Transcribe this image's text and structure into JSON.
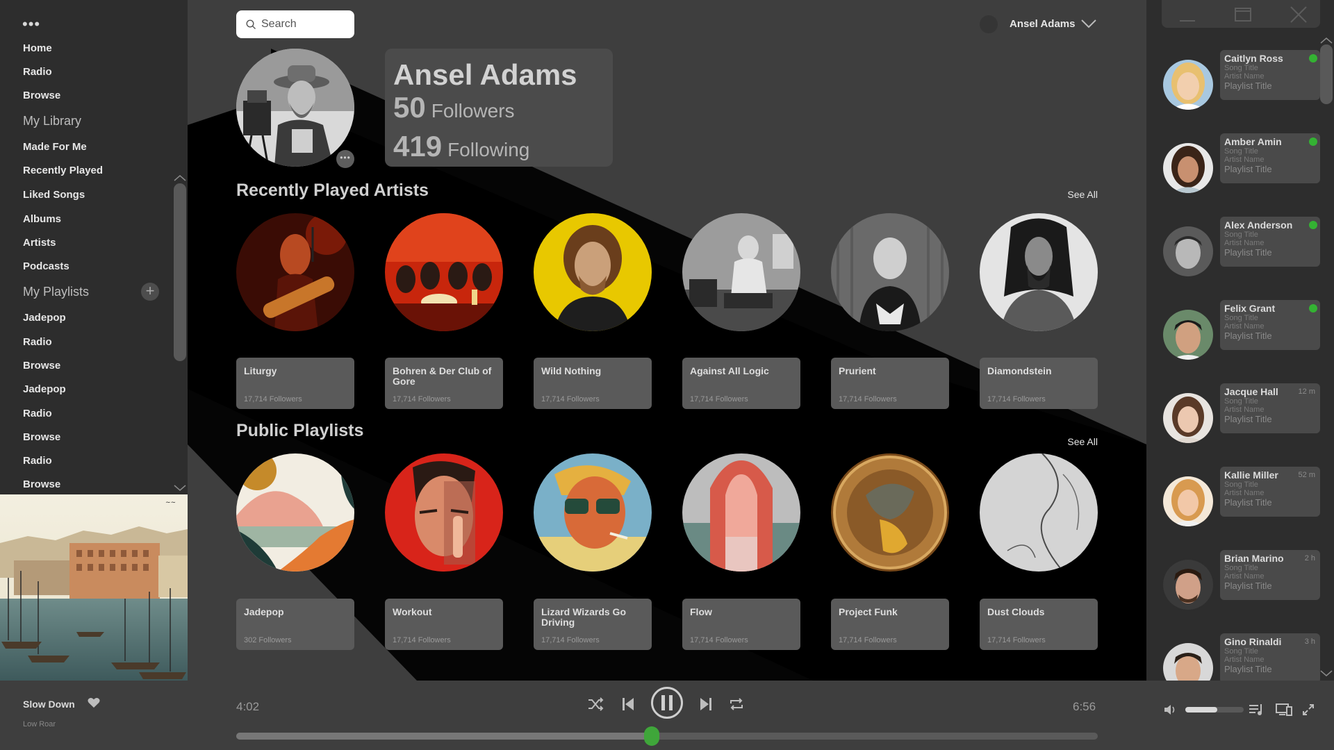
{
  "sidebar": {
    "menu_dots": "•••",
    "main_nav": [
      {
        "label": "Home"
      },
      {
        "label": "Radio"
      },
      {
        "label": "Browse"
      }
    ],
    "library_title": "My Library",
    "library_items": [
      {
        "label": "Made For Me"
      },
      {
        "label": "Recently Played"
      },
      {
        "label": "Liked Songs"
      },
      {
        "label": "Albums"
      },
      {
        "label": "Artists"
      },
      {
        "label": "Podcasts"
      }
    ],
    "playlists_title": "My Playlists",
    "add_playlist_icon": "+",
    "playlists": [
      {
        "label": "Jadepop"
      },
      {
        "label": "Radio"
      },
      {
        "label": "Browse"
      },
      {
        "label": "Jadepop"
      },
      {
        "label": "Radio"
      },
      {
        "label": "Browse"
      },
      {
        "label": "Radio"
      },
      {
        "label": "Browse"
      }
    ]
  },
  "header": {
    "search_placeholder": "Search",
    "user_name": "Ansel Adams"
  },
  "profile": {
    "name": "Ansel Adams",
    "followers_count": "50",
    "followers_label": "Followers",
    "following_count": "419",
    "following_label": "Following",
    "more_dots": "•••"
  },
  "recent_artists": {
    "title": "Recently Played Artists",
    "see_all": "See All",
    "items": [
      {
        "name": "Liturgy",
        "followers": "17,714 Followers"
      },
      {
        "name": "Bohren & Der Club of Gore",
        "followers": "17,714 Followers"
      },
      {
        "name": "Wild Nothing",
        "followers": "17,714 Followers"
      },
      {
        "name": "Against All Logic",
        "followers": "17,714 Followers"
      },
      {
        "name": "Prurient",
        "followers": "17,714 Followers"
      },
      {
        "name": "Diamondstein",
        "followers": "17,714 Followers"
      }
    ]
  },
  "public_playlists": {
    "title": "Public Playlists",
    "see_all": "See All",
    "items": [
      {
        "name": "Jadepop",
        "followers": "302 Followers"
      },
      {
        "name": "Workout",
        "followers": "17,714 Followers"
      },
      {
        "name": "Lizard Wizards Go Driving",
        "followers": "17,714 Followers"
      },
      {
        "name": "Flow",
        "followers": "17,714 Followers"
      },
      {
        "name": "Project Funk",
        "followers": "17,714 Followers"
      },
      {
        "name": "Dust Clouds",
        "followers": "17,714 Followers"
      }
    ]
  },
  "friends": [
    {
      "name": "Caitlyn Ross",
      "song": "Song Title",
      "artist": "Artist Name",
      "playlist": "Playlist Title",
      "status": "online",
      "time": ""
    },
    {
      "name": "Amber Amin",
      "song": "Song Title",
      "artist": "Artist Name",
      "playlist": "Playlist Title",
      "status": "online",
      "time": ""
    },
    {
      "name": "Alex Anderson",
      "song": "Song Title",
      "artist": "Artist Name",
      "playlist": "Playlist Title",
      "status": "online",
      "time": ""
    },
    {
      "name": "Felix Grant",
      "song": "Song Title",
      "artist": "Artist Name",
      "playlist": "Playlist Title",
      "status": "online",
      "time": ""
    },
    {
      "name": "Jacque Hall",
      "song": "Song Title",
      "artist": "Artist Name",
      "playlist": "Playlist Title",
      "status": "away",
      "time": "12 m"
    },
    {
      "name": "Kallie Miller",
      "song": "Song Title",
      "artist": "Artist Name",
      "playlist": "Playlist Title",
      "status": "away",
      "time": "52 m"
    },
    {
      "name": "Brian Marino",
      "song": "Song Title",
      "artist": "Artist Name",
      "playlist": "Playlist Title",
      "status": "away",
      "time": "2 h"
    },
    {
      "name": "Gino Rinaldi",
      "song": "Song Title",
      "artist": "Artist Name",
      "playlist": "Playlist Title",
      "status": "away",
      "time": "3 h"
    }
  ],
  "player": {
    "track_title": "Slow Down",
    "track_artist": "Low Roar",
    "elapsed": "4:02",
    "duration": "6:56",
    "progress": 0.482,
    "volume": 0.55,
    "icons": [
      "shuffle-icon",
      "previous-icon",
      "pause-icon",
      "next-icon",
      "repeat-icon",
      "volume-icon",
      "queue-icon",
      "devices-icon",
      "fullscreen-icon"
    ]
  },
  "colors": {
    "accent_green": "#3fa63a",
    "online_green": "#34b233",
    "background": "#3e3e3e",
    "panel": "#2d2d2d"
  }
}
